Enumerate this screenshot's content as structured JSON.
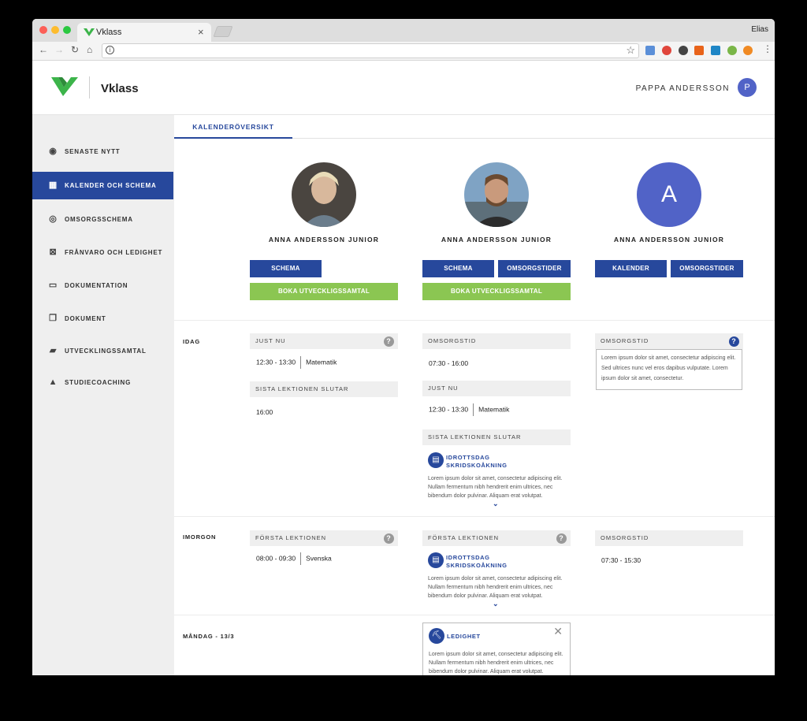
{
  "browser": {
    "tab_title": "Vklass",
    "user": "Elias",
    "tab_close": "×"
  },
  "header": {
    "brand": "Vklass",
    "user_name": "PAPPA ANDERSSON",
    "avatar_initial": "P",
    "accent": "#27489c",
    "logo_color": "#3cb44a"
  },
  "sidebar": {
    "items": [
      {
        "label": "SENASTE NYTT",
        "icon": "compass-icon"
      },
      {
        "label": "KALENDER OCH SCHEMA",
        "icon": "calendar-icon"
      },
      {
        "label": "OMSORGSSCHEMA",
        "icon": "eye-icon"
      },
      {
        "label": "FRÅNVARO OCH LEDIGHET",
        "icon": "calendar-x-icon"
      },
      {
        "label": "DOKUMENTATION",
        "icon": "clipboard-icon"
      },
      {
        "label": "DOKUMENT",
        "icon": "documents-icon"
      },
      {
        "label": "UTVECKLINGSSAMTAL",
        "icon": "chat-icon"
      },
      {
        "label": "STUDIECOACHING",
        "icon": "graduation-cap-icon"
      }
    ]
  },
  "main": {
    "tab": "KALENDERÖVERSIKT",
    "children": [
      {
        "name": "ANNA ANDERSSON JUNIOR",
        "buttons": [
          "SCHEMA"
        ],
        "green": "BOKA UTVECKLIGSSAMTAL"
      },
      {
        "name": "ANNA ANDERSSON JUNIOR",
        "buttons": [
          "SCHEMA",
          "OMSORGSTIDER"
        ],
        "green": "BOKA UTVECKLIGSSAMTAL"
      },
      {
        "name": "ANNA ANDERSSON JUNIOR",
        "initial": "A",
        "buttons": [
          "KALENDER",
          "OMSORGSTIDER"
        ]
      }
    ],
    "idag": {
      "label": "IDAG",
      "c1": {
        "h1": "JUST NU",
        "t1": "12:30 - 13:30",
        "s1": "Matematik",
        "h2": "SISTA LEKTIONEN SLUTAR",
        "t2": "16:00"
      },
      "c2": {
        "h1": "OMSORGSTID",
        "t1": "07:30 - 16:00",
        "h2": "JUST NU",
        "t2": "12:30 - 13:30",
        "s2": "Matematik",
        "h3": "SISTA LEKTIONEN SLUTAR",
        "ev_title1": "IDROTTSDAG",
        "ev_title2": "SKRIDSKOÅKNING",
        "ev_desc": "Lorem ipsum dolor sit amet, consectetur adipiscing elit. Nullam fermentum nibh hendrerit enim ultrices, nec bibendum dolor pulvinar. Aliquam erat volutpat."
      },
      "c3": {
        "h1": "OMSORGSTID",
        "box": "Lorem ipsum dolor sit amet, consectetur adipiscing elit. Sed ultrices nunc vel eros dapibus vulputate. Lorem ipsum dolor sit amet, consectetur."
      }
    },
    "imorgon": {
      "label": "IMORGON",
      "c1": {
        "h1": "FÖRSTA LEKTIONEN",
        "t1": "08:00 - 09:30",
        "s1": "Svenska"
      },
      "c2": {
        "h1": "FÖRSTA LEKTIONEN",
        "ev_title1": "IDROTTSDAG",
        "ev_title2": "SKRIDSKOÅKNING",
        "ev_desc": "Lorem ipsum dolor sit amet, consectetur adipiscing elit. Nullam fermentum nibh hendrerit enim ultrices, nec bibendum dolor pulvinar. Aliquam erat volutpat."
      },
      "c3": {
        "h1": "OMSORGSTID",
        "t1": "07:30 - 15:30"
      }
    },
    "mandag": {
      "label": "MÅNDAG - 13/3",
      "c2": {
        "title": "LEDIGHET",
        "desc": "Lorem ipsum dolor sit amet, consectetur adipiscing elit. Nullam fermentum nibh hendrerit enim ultrices, nec bibendum dolor pulvinar. Aliquam erat volutpat."
      }
    }
  }
}
